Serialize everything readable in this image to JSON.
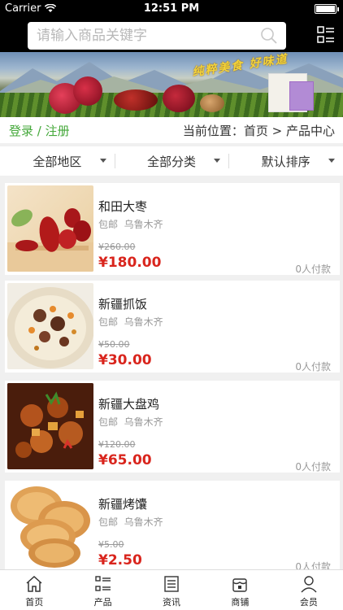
{
  "status_bar": {
    "carrier": "Carrier",
    "time": "12:51 PM"
  },
  "search": {
    "placeholder": "请输入商品关键字"
  },
  "banner": {
    "slogan": "纯粹美食 好味道"
  },
  "locbar": {
    "login": "登录 / 注册",
    "location": "当前位置：首页 > 产品中心"
  },
  "filters": [
    {
      "label": "全部地区"
    },
    {
      "label": "全部分类"
    },
    {
      "label": "默认排序"
    }
  ],
  "products": [
    {
      "name": "和田大枣",
      "ship_label": "包邮",
      "city": "乌鲁木齐",
      "old_price": "¥260.00",
      "price": "¥180.00",
      "sold": "0人付款",
      "image": "red-dates"
    },
    {
      "name": "新疆抓饭",
      "ship_label": "包邮",
      "city": "乌鲁木齐",
      "old_price": "¥50.00",
      "price": "¥30.00",
      "sold": "0人付款",
      "image": "pilaf"
    },
    {
      "name": "新疆大盘鸡",
      "ship_label": "包邮",
      "city": "乌鲁木齐",
      "old_price": "¥120.00",
      "price": "¥65.00",
      "sold": "0人付款",
      "image": "big-plate-chicken"
    },
    {
      "name": "新疆烤馕",
      "ship_label": "包邮",
      "city": "乌鲁木齐",
      "old_price": "¥5.00",
      "price": "¥2.50",
      "sold": "0人付款",
      "image": "naan"
    }
  ],
  "tabbar": [
    {
      "label": "首页",
      "icon": "home-icon"
    },
    {
      "label": "产品",
      "icon": "list-icon"
    },
    {
      "label": "资讯",
      "icon": "news-icon"
    },
    {
      "label": "商铺",
      "icon": "shop-icon"
    },
    {
      "label": "会员",
      "icon": "user-icon"
    }
  ],
  "colors": {
    "accent_green": "#44a83a",
    "price_red": "#d9251d",
    "header_bg": "#000000"
  }
}
